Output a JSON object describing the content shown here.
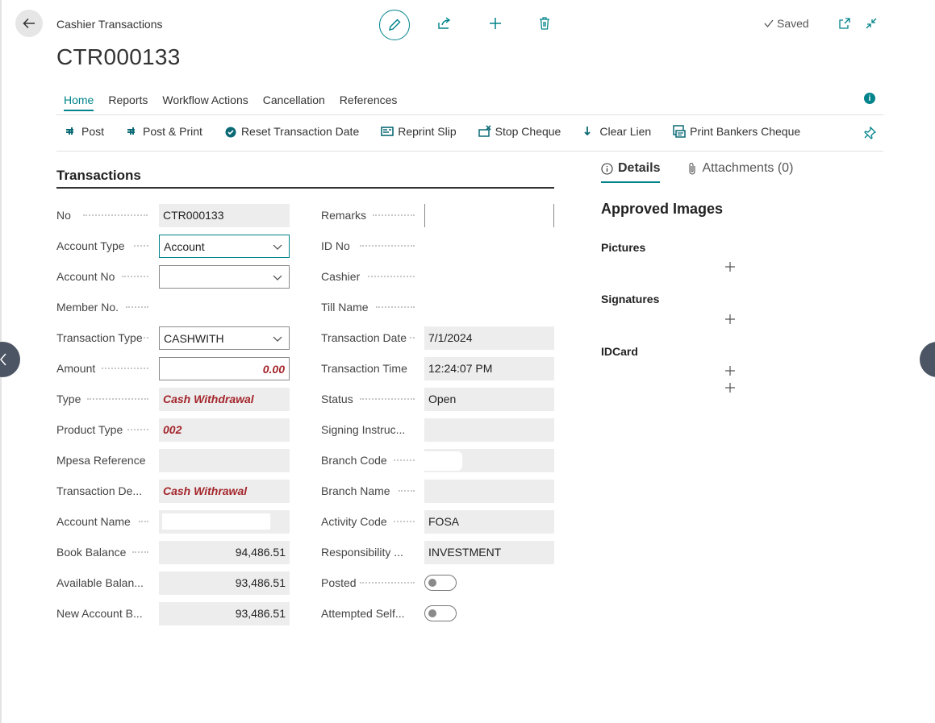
{
  "header": {
    "breadcrumb": "Cashier Transactions",
    "title": "CTR000133",
    "saved_label": "Saved"
  },
  "tabs": [
    {
      "label": "Home"
    },
    {
      "label": "Reports"
    },
    {
      "label": "Workflow Actions"
    },
    {
      "label": "Cancellation"
    },
    {
      "label": "References"
    }
  ],
  "actions": [
    {
      "label": "Post",
      "icon": "post-icon"
    },
    {
      "label": "Post & Print",
      "icon": "post-print-icon"
    },
    {
      "label": "Reset Transaction Date",
      "icon": "reset-icon"
    },
    {
      "label": "Reprint Slip",
      "icon": "reprint-icon"
    },
    {
      "label": "Stop Cheque",
      "icon": "stop-cheque-icon"
    },
    {
      "label": "Clear Lien",
      "icon": "clear-lien-icon"
    },
    {
      "label": "Print Bankers Cheque",
      "icon": "print-cheque-icon"
    }
  ],
  "section": {
    "title": "Transactions"
  },
  "left_fields": [
    {
      "label": "No",
      "value": "CTR000133"
    },
    {
      "label": "Account Type",
      "value": "Account"
    },
    {
      "label": "Account No",
      "value": ""
    },
    {
      "label": "Member No.",
      "value": ""
    },
    {
      "label": "Transaction Type",
      "value": "CASHWITH"
    },
    {
      "label": "Amount",
      "value": "0.00"
    },
    {
      "label": "Type",
      "value": "Cash Withdrawal"
    },
    {
      "label": "Product Type",
      "value": "002"
    },
    {
      "label": "Mpesa Reference",
      "value": ""
    },
    {
      "label": "Transaction De...",
      "value": "Cash Withrawal"
    },
    {
      "label": "Account Name",
      "value": ""
    },
    {
      "label": "Book Balance",
      "value": "94,486.51"
    },
    {
      "label": "Available Balan...",
      "value": "93,486.51"
    },
    {
      "label": "New Account B...",
      "value": "93,486.51"
    }
  ],
  "right_fields": [
    {
      "label": "Remarks",
      "value": ""
    },
    {
      "label": "ID No",
      "value": ""
    },
    {
      "label": "Cashier",
      "value": ""
    },
    {
      "label": "Till Name",
      "value": ""
    },
    {
      "label": "Transaction Date",
      "value": "7/1/2024"
    },
    {
      "label": "Transaction Time",
      "value": "12:24:07 PM"
    },
    {
      "label": "Status",
      "value": "Open"
    },
    {
      "label": "Signing Instruc...",
      "value": ""
    },
    {
      "label": "Branch Code",
      "value": ""
    },
    {
      "label": "Branch Name",
      "value": ""
    },
    {
      "label": "Activity Code",
      "value": "FOSA"
    },
    {
      "label": "Responsibility ...",
      "value": "INVESTMENT"
    },
    {
      "label": "Posted",
      "value": false
    },
    {
      "label": "Attempted Self...",
      "value": false
    }
  ],
  "factbox": {
    "tab_details": "Details",
    "tab_attachments": "Attachments (0)",
    "title": "Approved Images",
    "pictures": "Pictures",
    "signatures": "Signatures",
    "idcard": "IDCard"
  },
  "colors": {
    "accent": "#00838a",
    "error_text": "#a4262c",
    "readonly_bg": "#ededed"
  }
}
